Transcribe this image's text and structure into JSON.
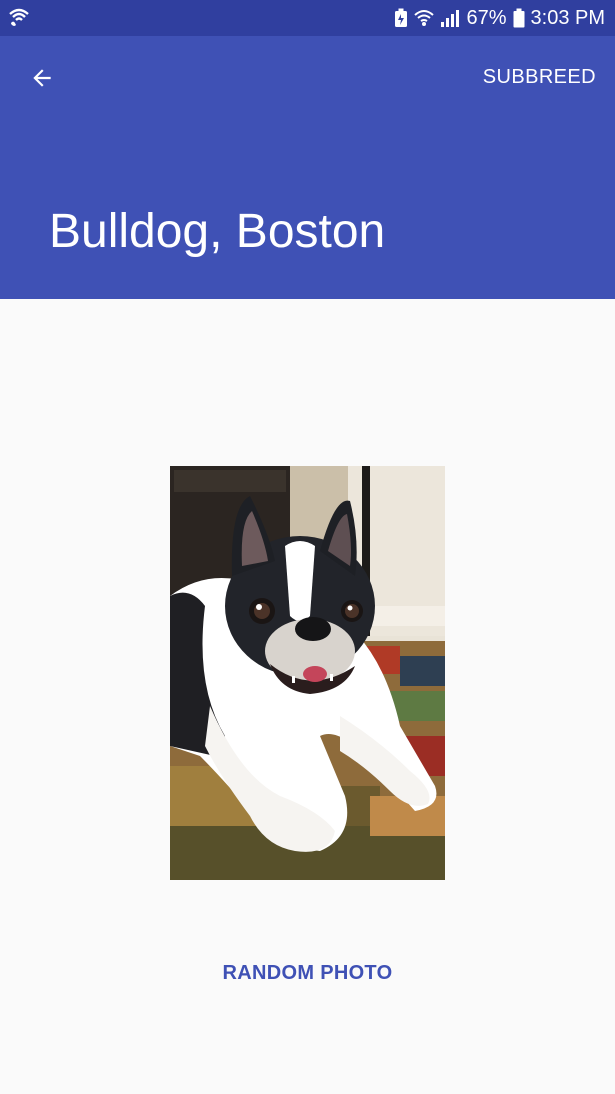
{
  "status_bar": {
    "battery_percent": "67%",
    "time": "3:03 PM",
    "icons": [
      "wifi-calling-icon",
      "battery-saver-icon",
      "wifi-icon",
      "signal-icon",
      "battery-icon"
    ]
  },
  "app_bar": {
    "back_icon": "arrow-back-icon",
    "action_label": "SUBBREED",
    "title": "Bulldog, Boston",
    "color": "#3f51b5",
    "status_color": "#303f9f"
  },
  "content": {
    "image_subject": "dog-photo",
    "random_button_label": "RANDOM PHOTO",
    "accent_color": "#3f51b5"
  }
}
